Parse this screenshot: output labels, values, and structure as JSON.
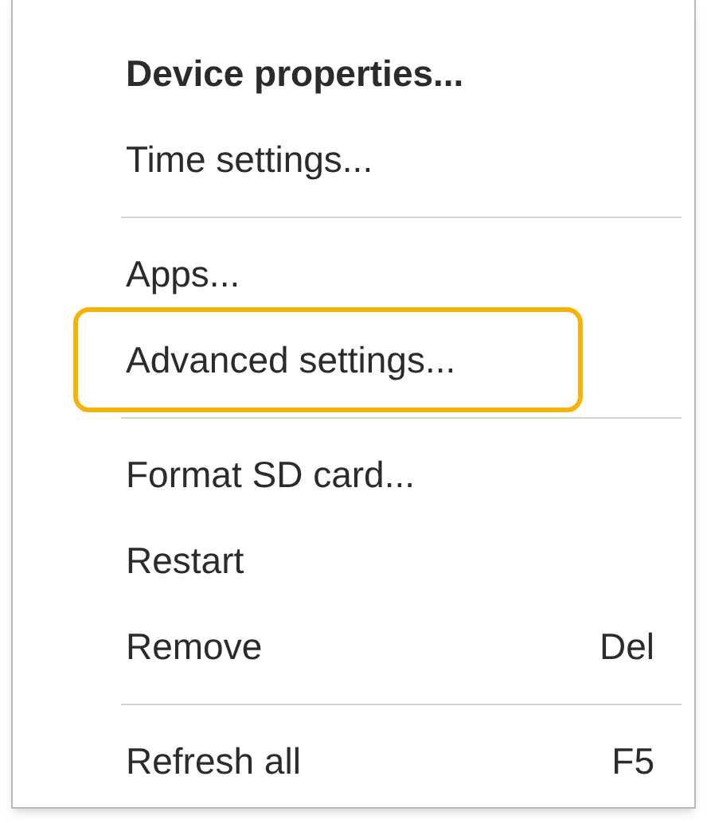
{
  "menu": [
    {
      "kind": "item",
      "label": "Device properties...",
      "bold": true,
      "highlighted": false
    },
    {
      "kind": "item",
      "label": "Time settings...",
      "bold": false,
      "highlighted": false
    },
    {
      "kind": "separator"
    },
    {
      "kind": "item",
      "label": "Apps...",
      "bold": false,
      "highlighted": false
    },
    {
      "kind": "item",
      "label": "Advanced settings...",
      "bold": false,
      "highlighted": true
    },
    {
      "kind": "separator"
    },
    {
      "kind": "item",
      "label": "Format SD card...",
      "bold": false,
      "highlighted": false
    },
    {
      "kind": "item",
      "label": "Restart",
      "bold": false,
      "highlighted": false
    },
    {
      "kind": "item",
      "label": "Remove",
      "shortcut": "Del",
      "bold": false,
      "highlighted": false
    },
    {
      "kind": "separator"
    },
    {
      "kind": "item",
      "label": "Refresh all",
      "shortcut": "F5",
      "bold": false,
      "highlighted": false
    }
  ]
}
